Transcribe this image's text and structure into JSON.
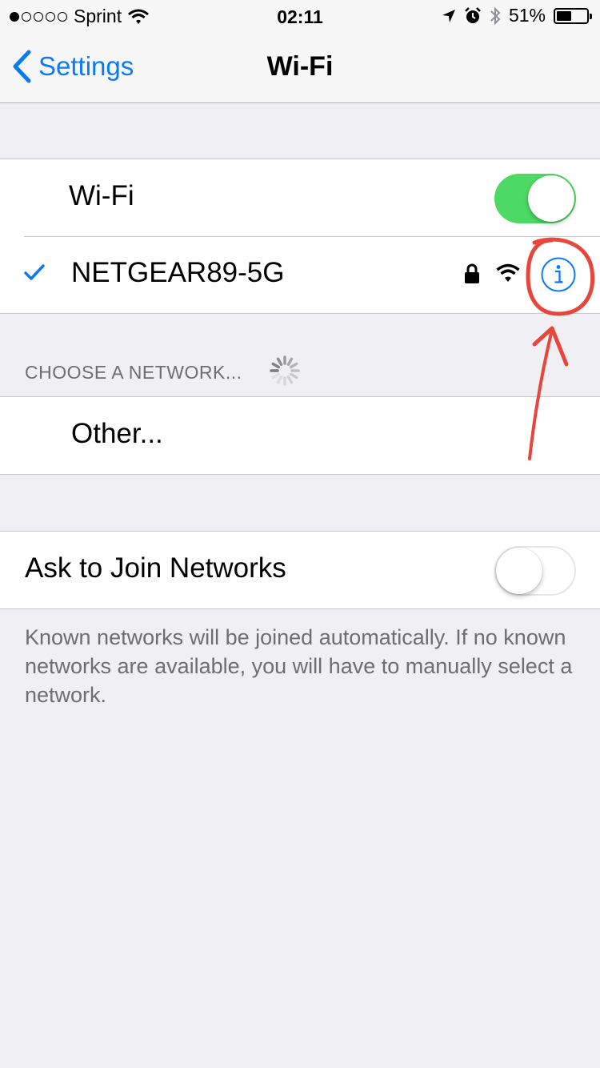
{
  "status_bar": {
    "carrier": "Sprint",
    "signal_bars_filled": 1,
    "signal_bars_total": 5,
    "time": "02:11",
    "battery_percent": "51%",
    "battery_level": 0.51
  },
  "nav": {
    "back_label": "Settings",
    "title": "Wi-Fi"
  },
  "wifi_toggle": {
    "label": "Wi-Fi",
    "on": true
  },
  "connected_network": {
    "name": "NETGEAR89-5G",
    "secured": true,
    "info_icon": "info-circle-icon"
  },
  "choose_network": {
    "header": "CHOOSE A NETWORK...",
    "other_label": "Other..."
  },
  "ask_to_join": {
    "label": "Ask to Join Networks",
    "on": false,
    "description": "Known networks will be joined automatically. If no known networks are available, you will have to manually select a network."
  },
  "colors": {
    "accent": "#0b7af6",
    "toggle_on": "#4cd964",
    "annotation": "#e8453c",
    "background": "#efeff4"
  }
}
